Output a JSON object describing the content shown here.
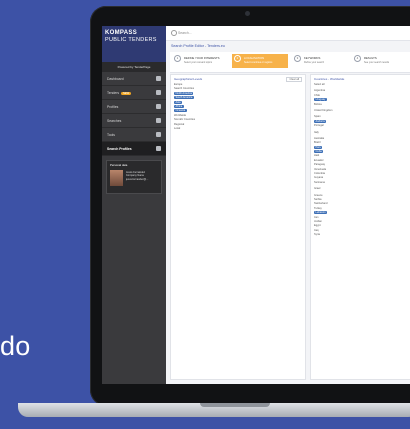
{
  "background_text": "do",
  "app": {
    "brand_line1": "KOMPASS",
    "brand_line2": "PUBLIC TENDERS",
    "powered_by": "Powered by TenderPage"
  },
  "sidebar": {
    "items": [
      {
        "label": "Dashboard",
        "badge": ""
      },
      {
        "label": "Tenders",
        "badge": "NEW"
      },
      {
        "label": "Profiles",
        "badge": ""
      },
      {
        "label": "Searches",
        "badge": ""
      },
      {
        "label": "Tools",
        "badge": ""
      },
      {
        "label": "Search Profiles",
        "badge": ""
      }
    ],
    "profile": {
      "title": "Personal data",
      "name": "Jesús Fernández",
      "company": "Company Name",
      "email": "jesus.fernandez@..."
    }
  },
  "topbar": {
    "search_placeholder": "Search..."
  },
  "page_title": "Search Profile Editor - Tenders.eu",
  "steps": [
    {
      "num": "1",
      "title": "DEFINE YOUR INTERESTS",
      "sub": "Select your relevant topics"
    },
    {
      "num": "2",
      "title": "LOCALISATION",
      "sub": "Select countries or regions"
    },
    {
      "num": "3",
      "title": "KEYWORDS",
      "sub": "Refine your search"
    },
    {
      "num": "4",
      "title": "RESULTS",
      "sub": "See your search results"
    }
  ],
  "left_panel": {
    "heading": "Geographical Levels",
    "clear": "Clear all",
    "rows": [
      {
        "text": "Europe",
        "chip": false
      },
      {
        "text": "Search Countries",
        "chip": false
      },
      {
        "text": "North America",
        "chip": true
      },
      {
        "text": "South America",
        "chip": true
      },
      {
        "text": "Asia",
        "chip": true
      },
      {
        "text": "Africa",
        "chip": true
      },
      {
        "text": "Oceania",
        "chip": true
      },
      {
        "text": "Worldwide",
        "chip": false
      },
      {
        "text": "Non-EU Countries",
        "chip": false
      },
      {
        "text": "Regional",
        "chip": false
      },
      {
        "text": "Local",
        "chip": false
      }
    ]
  },
  "right_panel": {
    "heading": "Countries - Worldwide",
    "rows": [
      {
        "text": "Select all",
        "chip": false
      },
      {
        "text": "",
        "chip": false,
        "sep": true
      },
      {
        "text": "Argentina",
        "chip": false
      },
      {
        "text": "Chile",
        "chip": false
      },
      {
        "text": "Uruguay",
        "chip": true
      },
      {
        "text": "Bolivia",
        "chip": false
      },
      {
        "text": "",
        "chip": false,
        "sep": true
      },
      {
        "text": "United Kingdom",
        "chip": false
      },
      {
        "text": "",
        "chip": false,
        "sep": true
      },
      {
        "text": "Spain",
        "chip": false
      },
      {
        "text": "Andorra",
        "chip": true
      },
      {
        "text": "Portugal",
        "chip": false
      },
      {
        "text": "",
        "chip": false,
        "sep": true
      },
      {
        "text": "Italy",
        "chip": false
      },
      {
        "text": "",
        "chip": false,
        "sep": true
      },
      {
        "text": "Australia",
        "chip": false
      },
      {
        "text": "Brazil",
        "chip": false
      },
      {
        "text": "Peru",
        "chip": true
      },
      {
        "text": "Cuba",
        "chip": true
      },
      {
        "text": "Haiti",
        "chip": false
      },
      {
        "text": "Ecuador",
        "chip": false
      },
      {
        "text": "Paraguay",
        "chip": false
      },
      {
        "text": "Venezuela",
        "chip": false
      },
      {
        "text": "Colombia",
        "chip": false
      },
      {
        "text": "Guyana",
        "chip": false
      },
      {
        "text": "Suriname",
        "chip": false
      },
      {
        "text": "",
        "chip": false,
        "sep": true
      },
      {
        "text": "Israel",
        "chip": false
      },
      {
        "text": "",
        "chip": false,
        "sep": true
      },
      {
        "text": "Greece",
        "chip": false
      },
      {
        "text": "Serbia",
        "chip": false
      },
      {
        "text": "Switzerland",
        "chip": false
      },
      {
        "text": "Turkey",
        "chip": false
      },
      {
        "text": "Lebanon",
        "chip": true
      },
      {
        "text": "Iran",
        "chip": false
      },
      {
        "text": "Jordan",
        "chip": false
      },
      {
        "text": "Egypt",
        "chip": false
      },
      {
        "text": "Iraq",
        "chip": false
      },
      {
        "text": "Syria",
        "chip": false
      }
    ]
  },
  "colors": {
    "background": "#3d52a6",
    "accent": "#f7b24a",
    "chip": "#3d6fb6",
    "sidebar": "#3a3a3d"
  }
}
